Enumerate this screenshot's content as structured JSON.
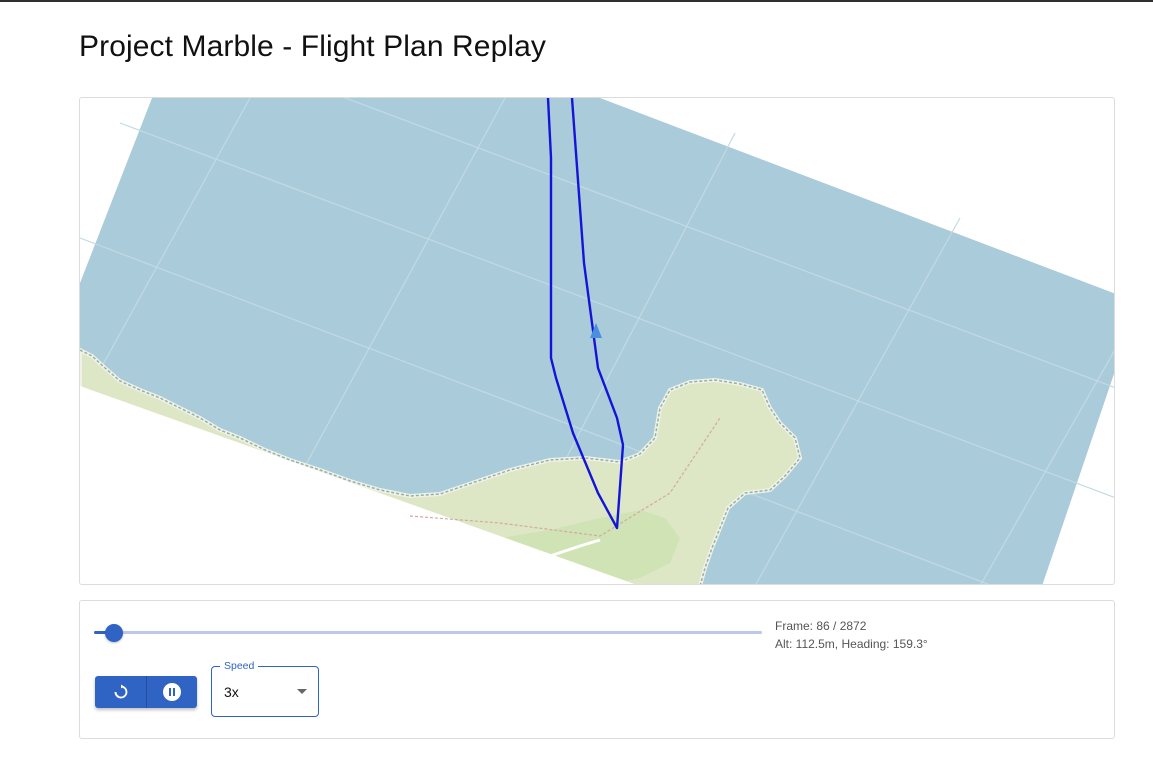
{
  "page": {
    "title": "Project Marble - Flight Plan Replay"
  },
  "map": {
    "water_color": "#aacbd9",
    "land_color": "#dde7c6",
    "flight_path_color": "#1414d9",
    "aircraft_marker_color": "#4a8ee0"
  },
  "playback": {
    "frame_label": "Frame: 86 / 2872",
    "telemetry_label": "Alt: 112.5m, Heading: 159.3°",
    "progress_fraction": 0.03,
    "restart_icon": "restart-icon",
    "pause_icon": "pause-icon",
    "speed": {
      "label": "Speed",
      "value": "3x"
    }
  },
  "colors": {
    "accent": "#2f63c4",
    "track": "#bcc8ea"
  }
}
